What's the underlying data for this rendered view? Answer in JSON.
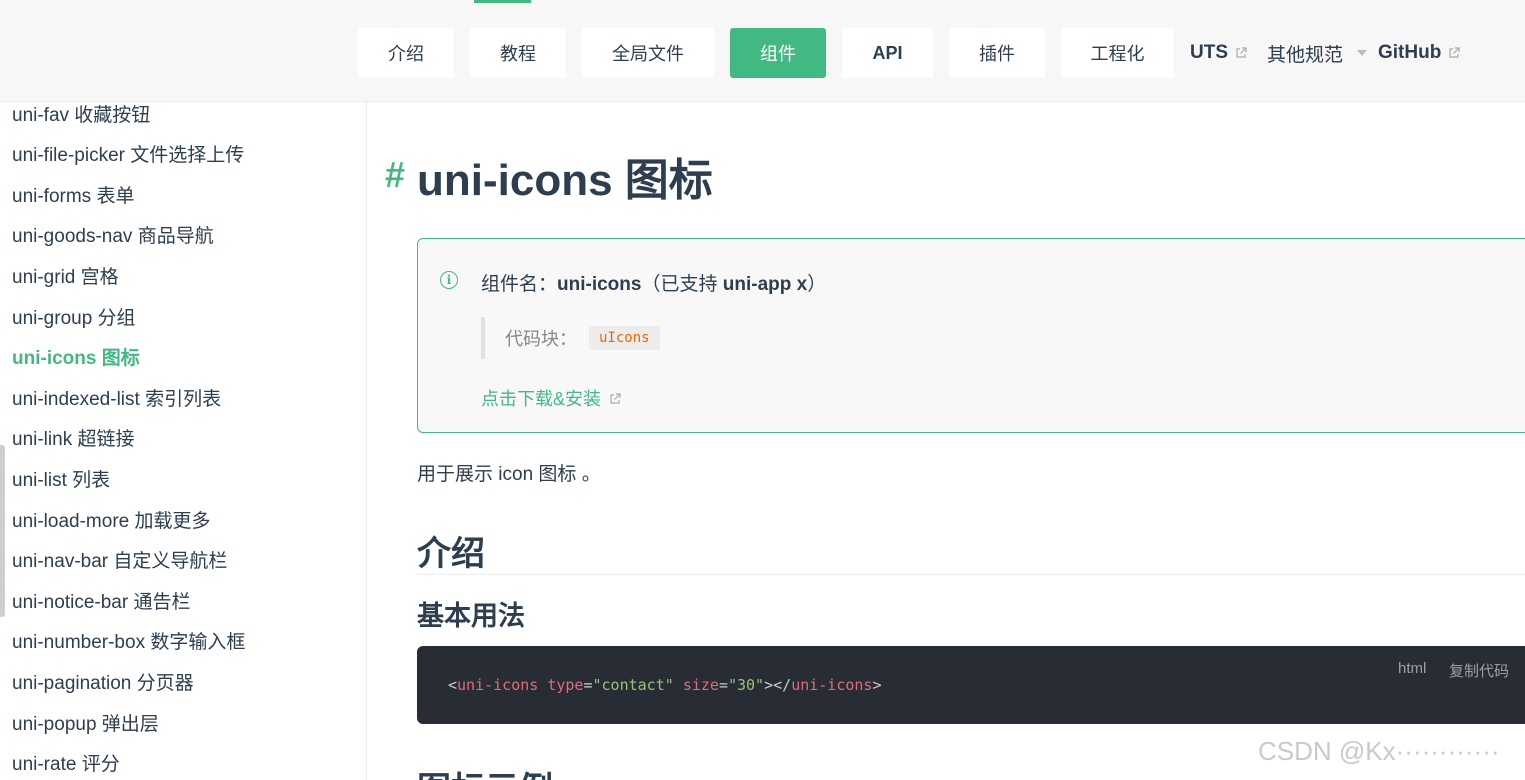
{
  "nav": {
    "buttons": [
      {
        "label": "介绍"
      },
      {
        "label": "教程"
      },
      {
        "label": "全局文件"
      },
      {
        "label": "组件"
      },
      {
        "label": "API"
      },
      {
        "label": "插件"
      },
      {
        "label": "工程化"
      }
    ],
    "links": [
      {
        "label": "UTS"
      },
      {
        "label": "其他规范"
      },
      {
        "label": "GitHub"
      }
    ],
    "active_color": "#42b983"
  },
  "sidebar": {
    "items": [
      {
        "label": "uni-fav 收藏按钮"
      },
      {
        "label": "uni-file-picker 文件选择上传"
      },
      {
        "label": "uni-forms 表单"
      },
      {
        "label": "uni-goods-nav 商品导航"
      },
      {
        "label": "uni-grid 宫格"
      },
      {
        "label": "uni-group 分组"
      },
      {
        "label": "uni-icons 图标"
      },
      {
        "label": "uni-indexed-list 索引列表"
      },
      {
        "label": "uni-link 超链接"
      },
      {
        "label": "uni-list 列表"
      },
      {
        "label": "uni-load-more 加载更多"
      },
      {
        "label": "uni-nav-bar 自定义导航栏"
      },
      {
        "label": "uni-notice-bar 通告栏"
      },
      {
        "label": "uni-number-box 数字输入框"
      },
      {
        "label": "uni-pagination 分页器"
      },
      {
        "label": "uni-popup 弹出层"
      },
      {
        "label": "uni-rate 评分"
      }
    ]
  },
  "main": {
    "hash": "#",
    "title": "uni-icons 图标",
    "info": {
      "prefix": "组件名：",
      "component": "uni-icons",
      "paren_open": "（已支持 ",
      "support": "uni-app x",
      "paren_close": "）",
      "quote_label": "代码块：",
      "code_snippet": "uIcons",
      "download_link": "点击下载&安装"
    },
    "description": "用于展示 icon 图标 。",
    "h2_intro": "介绍",
    "h3_basic": "基本用法",
    "code": {
      "lang": "html",
      "copy": "复制代码",
      "open_lt": "<",
      "tag": "uni-icons",
      "attr1": "type",
      "eq1": "=",
      "val1": "\"contact\"",
      "attr2": "size",
      "eq2": "=",
      "val2": "\"30\"",
      "close_gt": "></",
      "tag_close": "uni-icons",
      "end_gt": ">"
    },
    "h2_examples": "图标示例"
  },
  "watermark": "CSDN @Kx············"
}
